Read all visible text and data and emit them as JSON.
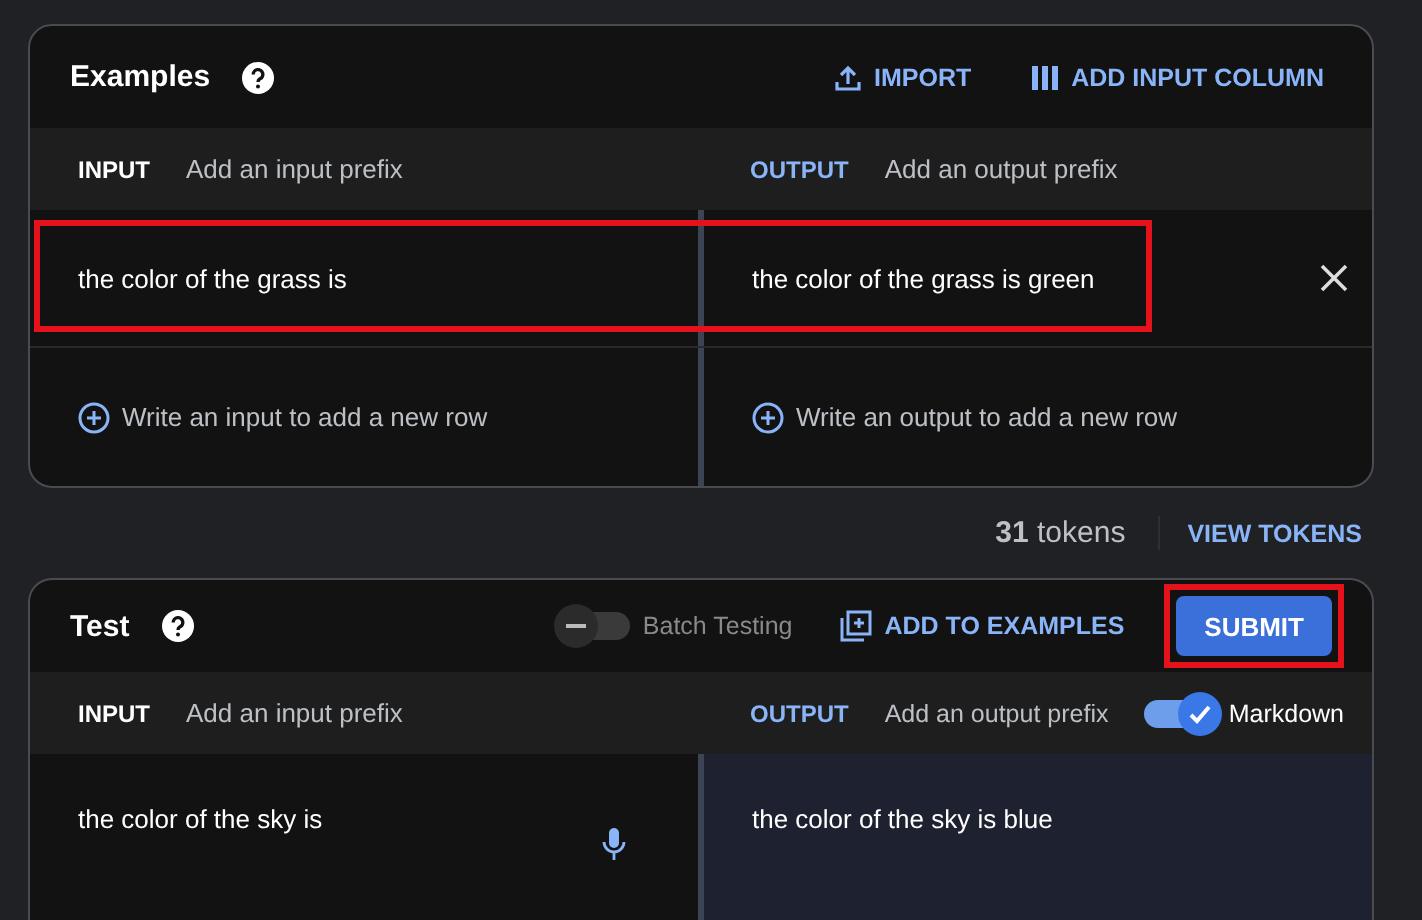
{
  "examples": {
    "title": "Examples",
    "actions": [
      {
        "kind": "import",
        "label": "IMPORT"
      },
      {
        "kind": "columns",
        "label": "ADD INPUT COLUMN"
      }
    ],
    "input_label": "INPUT",
    "input_prefix_placeholder": "Add an input prefix",
    "output_label": "OUTPUT",
    "output_prefix_placeholder": "Add an output prefix",
    "rows": [
      {
        "input": "the color of the grass is",
        "output": "the color of the grass is green",
        "highlighted": true
      }
    ],
    "add_input_placeholder": "Write an input to add a new row",
    "add_output_placeholder": "Write an output to add a new row"
  },
  "token_count": "**31** tokens",
  "view_tokens": "VIEW TOKENS",
  "test": {
    "title": "Test",
    "batch_toggle": {
      "label": "Batch Testing",
      "on": false
    },
    "add_to_examples": "ADD TO EXAMPLES",
    "submit": {
      "label": "SUBMIT",
      "highlighted": true
    },
    "input_label": "INPUT",
    "input_prefix_placeholder": "Add an input prefix",
    "output_label": "OUTPUT",
    "output_prefix_placeholder": "Add an output prefix",
    "markdown_toggle": {
      "label": "Markdown",
      "on": true
    },
    "input": "the color of the sky is",
    "output": "the color of the sky is blue"
  }
}
